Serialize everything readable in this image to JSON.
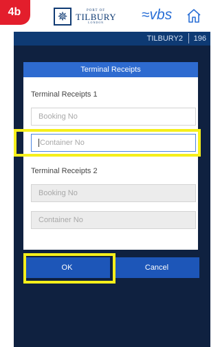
{
  "step_badge": "4b",
  "header": {
    "logo_top": "PORT OF",
    "logo_main": "TILBURY",
    "logo_bottom": "LONDON",
    "brand": "≈vbs",
    "home_icon": "home-icon"
  },
  "status": {
    "site": "TILBURY2",
    "number": "196"
  },
  "dialog": {
    "title": "Terminal Receipts",
    "section1": {
      "label": "Terminal Receipts 1",
      "booking_placeholder": "Booking No",
      "container_placeholder": "Container No"
    },
    "section2": {
      "label": "Terminal Receipts 2",
      "booking_placeholder": "Booking No",
      "container_placeholder": "Container No"
    }
  },
  "buttons": {
    "ok": "OK",
    "cancel": "Cancel"
  },
  "colors": {
    "highlight": "#f5ef1b",
    "badge": "#e31e2c",
    "primary": "#1d56b8",
    "background": "#0f2140"
  }
}
